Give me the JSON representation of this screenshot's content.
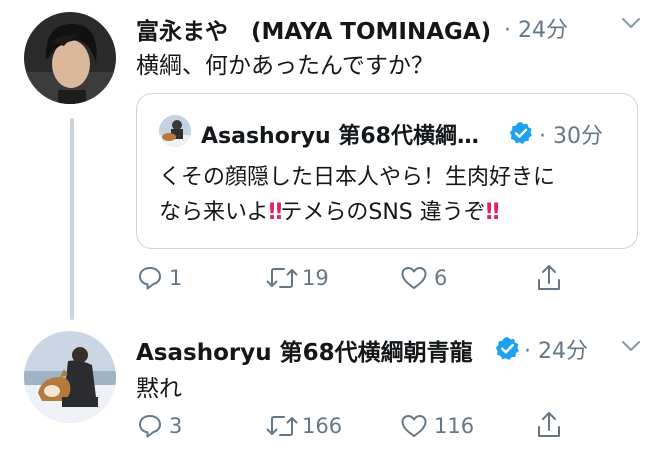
{
  "colors": {
    "text": "#14171a",
    "muted": "#657786",
    "border": "#ccd6dd",
    "verified": "#1da1f2",
    "exclaim": "#e0245e",
    "thread": "#c9d4dc"
  },
  "tweet1": {
    "display_name": "富永まや　(MAYA TOMINAGA)",
    "time": "· 24分",
    "text": "横綱、何かあったんですか？",
    "quoted": {
      "display_name": "Asashoryu 第68代横綱…",
      "time": "· 30分",
      "line1": "くその顔隠した日本人やら！生肉好きに",
      "line2_a": "なら来いよ",
      "line2_b": "テメらのSNS 違うぞ",
      "exclaim": "‼"
    },
    "actions": {
      "replies": "1",
      "retweets": "19",
      "likes": "6"
    }
  },
  "tweet2": {
    "display_name": "Asashoryu 第68代横綱朝青龍",
    "time": "· 24分",
    "text": "黙れ",
    "actions": {
      "replies": "3",
      "retweets": "166",
      "likes": "116"
    }
  },
  "icons": [
    "reply-icon",
    "retweet-icon",
    "like-icon",
    "share-icon",
    "chevron-down-icon",
    "verified-badge-icon"
  ]
}
